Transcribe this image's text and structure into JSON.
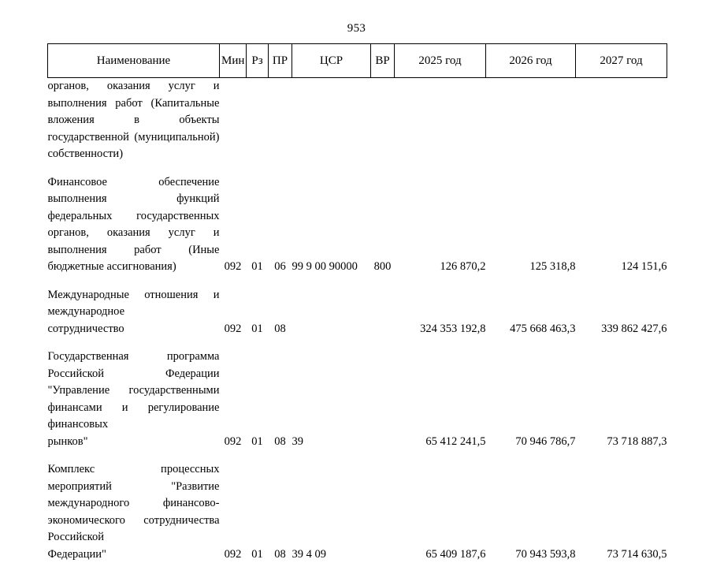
{
  "document": {
    "page_number": "953"
  },
  "table": {
    "headers": {
      "name": "Наименование",
      "min": "Мин",
      "rz": "Рз",
      "pr": "ПР",
      "csr": "ЦСР",
      "vr": "ВР",
      "year1": "2025 год",
      "year2": "2026 год",
      "year3": "2027 год"
    },
    "rows": [
      {
        "name_lines": [
          "органов, оказания услуг и выполнения работ (Капитальные вложения в объекты государственной (муниципальной)",
          "собственности)"
        ],
        "min": "",
        "rz": "",
        "pr": "",
        "csr": "",
        "vr": "",
        "year1": "",
        "year2": "",
        "year3": ""
      },
      {
        "name_lines": [
          "Финансовое обеспечение выполнения функций федеральных государственных органов, оказания услуг и выполнения работ (Иные",
          "бюджетные ассигнования)"
        ],
        "min": "092",
        "rz": "01",
        "pr": "06",
        "csr": "99 9 00 90000",
        "vr": "800",
        "year1": "126 870,2",
        "year2": "125 318,8",
        "year3": "124 151,6"
      },
      {
        "name_lines": [
          "Международные отношения и международное",
          "сотрудничество"
        ],
        "min": "092",
        "rz": "01",
        "pr": "08",
        "csr": "",
        "vr": "",
        "year1": "324 353 192,8",
        "year2": "475 668 463,3",
        "year3": "339 862 427,6"
      },
      {
        "name_lines": [
          "Государственная программа Российской Федерации \"Управление государственными финансами и регулирование финансовых",
          "рынков\""
        ],
        "min": "092",
        "rz": "01",
        "pr": "08",
        "csr": "39",
        "vr": "",
        "year1": "65 412 241,5",
        "year2": "70 946 786,7",
        "year3": "73 718 887,3"
      },
      {
        "name_lines": [
          "Комплекс процессных мероприятий \"Развитие международного финансово-экономического сотрудничества Российской",
          "Федерации\""
        ],
        "min": "092",
        "rz": "01",
        "pr": "08",
        "csr": "39 4 09",
        "vr": "",
        "year1": "65 409 187,6",
        "year2": "70 943 593,8",
        "year3": "73 714 630,5"
      }
    ]
  }
}
